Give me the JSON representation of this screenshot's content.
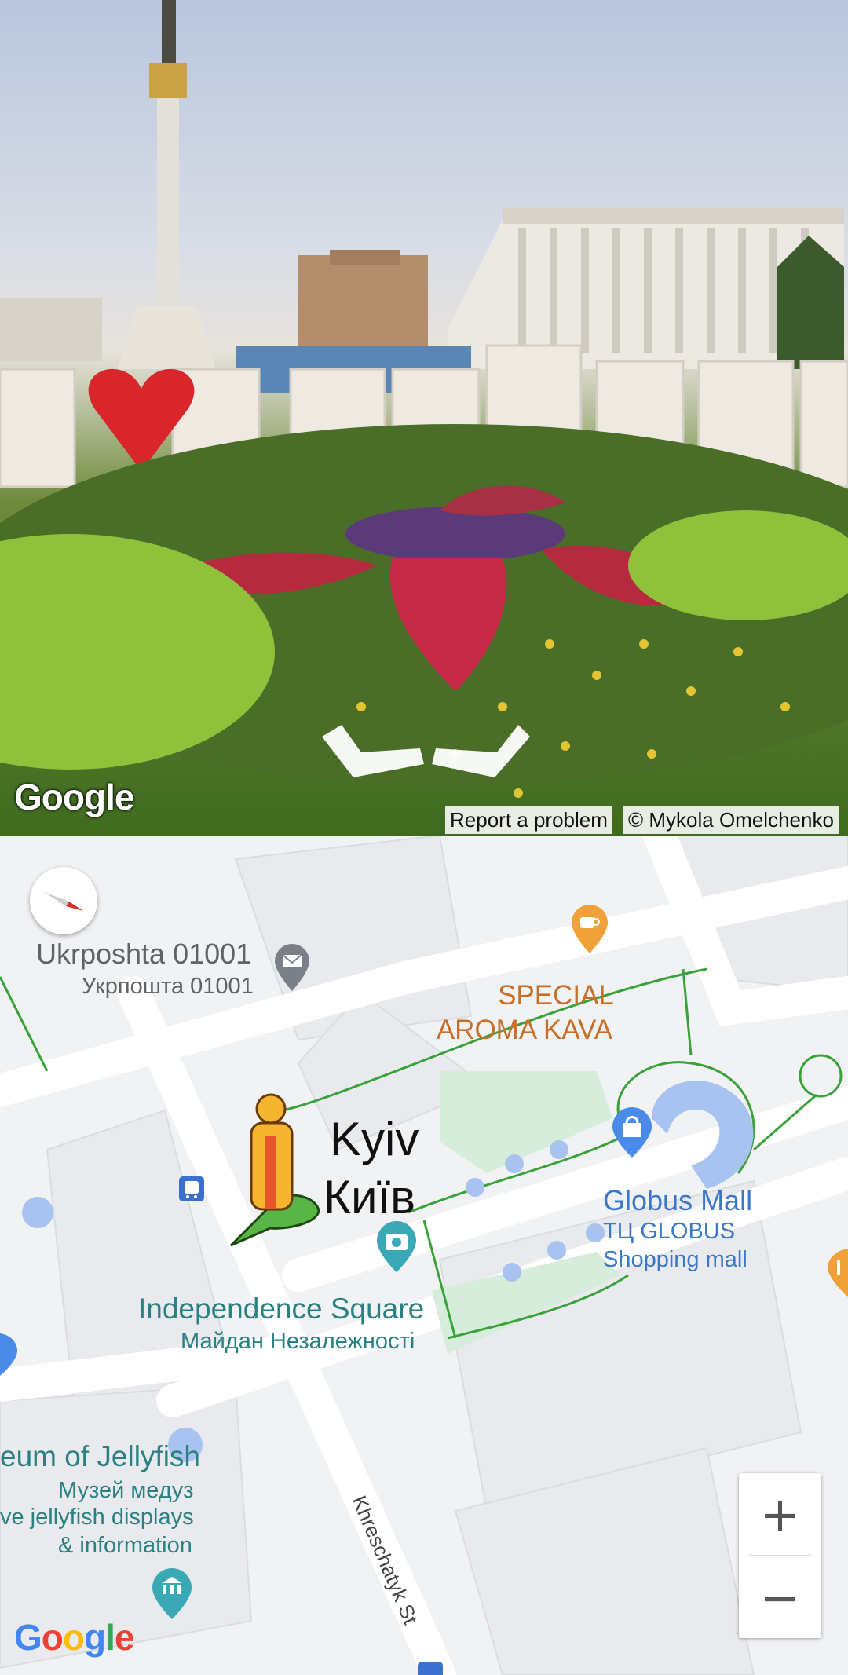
{
  "street_view": {
    "logo": "Google",
    "report_label": "Report a problem",
    "copyright": "© Mykola Omelchenko"
  },
  "map": {
    "compass_icon": "compass-icon",
    "labels": {
      "ukrposhta_en": "Ukrposhta 01001",
      "ukrposhta_uk": "Укрпошта 01001",
      "cafe_line1": "SPECIAL",
      "cafe_line2": "AROMA KAVA",
      "city_en": "Kyiv",
      "city_uk": "Київ",
      "globus_en": "Globus Mall",
      "globus_uk": "ТЦ GLOBUS",
      "globus_type": "Shopping mall",
      "square_en": "Independence Square",
      "square_uk": "Майдан Незалежності",
      "museum_en": "eum of Jellyfish",
      "museum_uk": "Музей медуз",
      "museum_desc1": "ve jellyfish displays",
      "museum_desc2": "& information",
      "street": "Khreschatyk St"
    },
    "zoom_in": "+",
    "zoom_out": "−",
    "logo": "Google",
    "logo_colors": [
      "#4285F4",
      "#EA4335",
      "#FBBC05",
      "#4285F4",
      "#34A853",
      "#EA4335"
    ]
  }
}
